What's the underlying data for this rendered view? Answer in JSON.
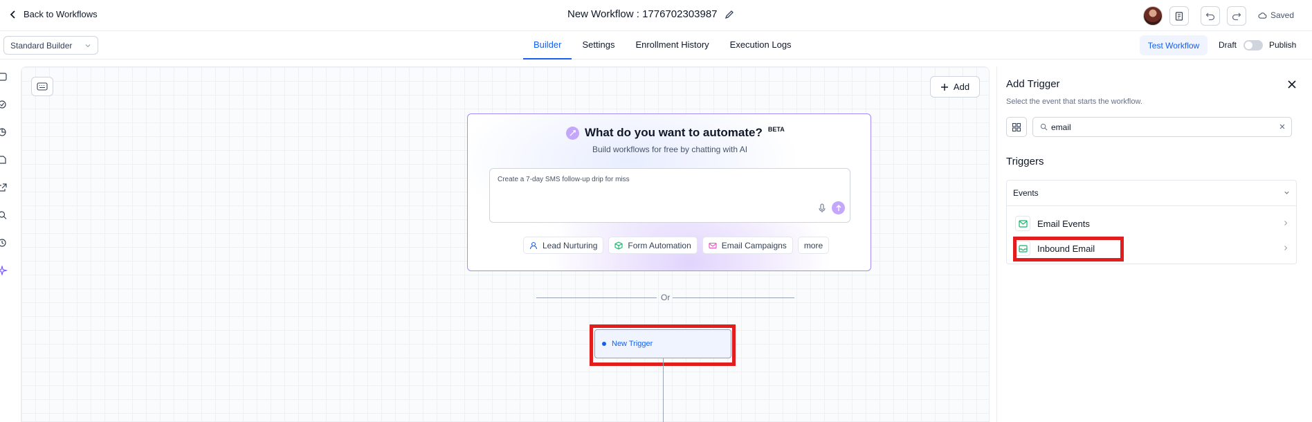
{
  "header": {
    "back_label": "Back to Workflows",
    "workflow_title": "New Workflow : 1776702303987",
    "saved_label": "Saved"
  },
  "subbar": {
    "builder_select": "Standard Builder",
    "tabs": [
      {
        "label": "Builder",
        "active": true
      },
      {
        "label": "Settings",
        "active": false
      },
      {
        "label": "Enrollment History",
        "active": false
      },
      {
        "label": "Execution Logs",
        "active": false
      }
    ],
    "test_label": "Test Workflow",
    "draft_label": "Draft",
    "publish_label": "Publish",
    "published": false
  },
  "canvas": {
    "add_label": "Add",
    "ai": {
      "title": "What do you want to automate?",
      "badge": "BETA",
      "subtitle": "Build workflows for free by chatting with AI",
      "input_text": "Create a 7-day SMS follow-up drip for miss",
      "chips": [
        "Lead Nurturing",
        "Form Automation",
        "Email Campaigns",
        "more"
      ]
    },
    "or_label": "Or",
    "trigger_node_label": "New Trigger"
  },
  "panel": {
    "title": "Add Trigger",
    "subtitle": "Select the event that starts the workflow.",
    "search_value": "email",
    "section_title": "Triggers",
    "group_label": "Events",
    "items": [
      "Email Events",
      "Inbound Email"
    ]
  },
  "colors": {
    "accent": "#155eef",
    "ai_purple": "#a48afb",
    "highlight_red": "#e11d1d",
    "email_green": "#12b76a"
  }
}
